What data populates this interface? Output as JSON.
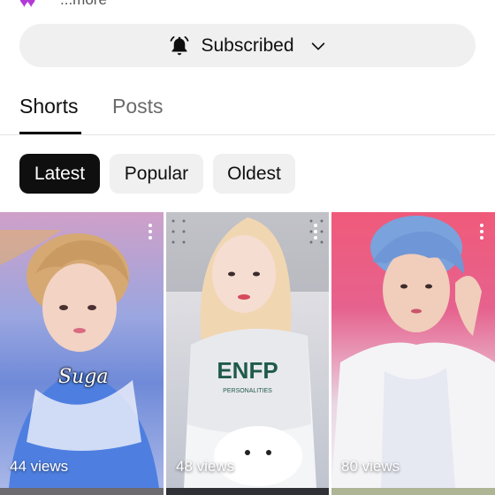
{
  "channel": {
    "description_more": "...more",
    "heart_colors": [
      "#8e3bd6",
      "#e0306a"
    ]
  },
  "subscribe": {
    "label": "Subscribed",
    "bell_icon": "bell-icon",
    "chevron_icon": "chevron-down-icon"
  },
  "tabs": [
    {
      "label": "Shorts",
      "active": true
    },
    {
      "label": "Posts",
      "active": false
    }
  ],
  "filters": [
    {
      "label": "Latest",
      "selected": true
    },
    {
      "label": "Popular",
      "selected": false
    },
    {
      "label": "Oldest",
      "selected": false
    }
  ],
  "shorts": [
    {
      "views": "44 views",
      "overlay_text": "Suga"
    },
    {
      "views": "48 views",
      "shirt_text": "ENFP",
      "shirt_subtext": "PERSONALITIES"
    },
    {
      "views": "80 views"
    }
  ],
  "colors": {
    "chip_selected_bg": "#0f0f0f",
    "chip_bg": "#f0f0f0",
    "button_bg": "#f0f0f0",
    "tab_inactive": "#6b6b6b"
  }
}
